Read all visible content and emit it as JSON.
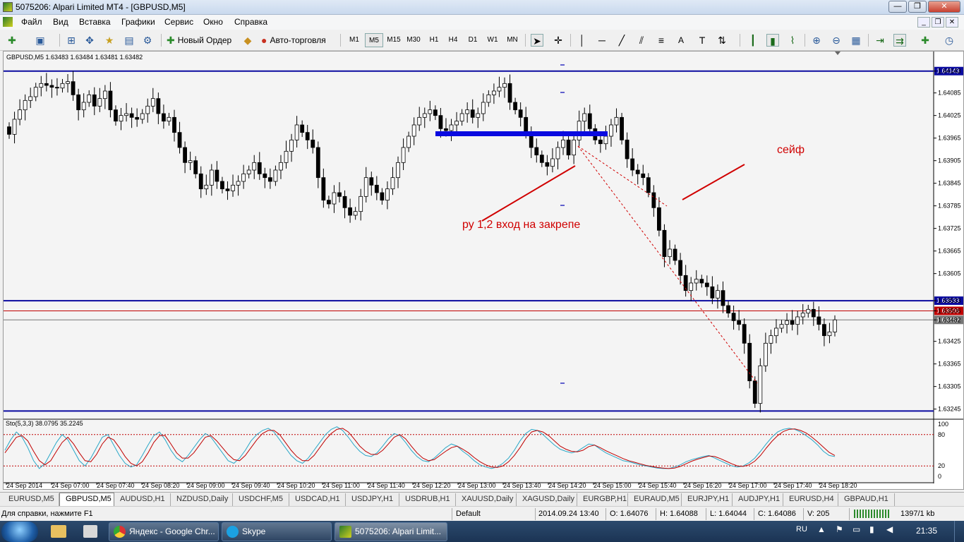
{
  "window": {
    "title": "5075206: Alpari Limited MT4 - [GBPUSD,M5]",
    "controls": [
      "—",
      "❐",
      "✕"
    ]
  },
  "menu": [
    "Файл",
    "Вид",
    "Вставка",
    "Графики",
    "Сервис",
    "Окно",
    "Справка"
  ],
  "toolbar": {
    "new_order": "Новый Ордер",
    "auto_trading": "Авто-торговля",
    "timeframes": [
      "M1",
      "M5",
      "M15",
      "M30",
      "H1",
      "H4",
      "D1",
      "W1",
      "MN"
    ],
    "selected_timeframe": "M5",
    "text_tool": "A"
  },
  "chart": {
    "header": "GBPUSD,M5  1.63483 1.63484 1.63481 1.63482",
    "annotation_entry": "ру 1,2 вход на закрепе",
    "annotation_safe": "сейф",
    "indicator_header": "Sto(5,3,3) 38.0795 35.2245",
    "colors": {
      "up": "#00c000",
      "down": "#000000",
      "hline_blue": "#0a0aa0",
      "hline_red": "#c00000",
      "annotation": "#d00000",
      "stoch_main": "#2aa8c8",
      "stoch_signal": "#c00000"
    }
  },
  "chart_data": {
    "type": "candlestick",
    "symbol": "GBPUSD",
    "timeframe": "M5",
    "price_axis_labels": [
      "1.64143",
      "1.64085",
      "1.64025",
      "1.63965",
      "1.63905",
      "1.63845",
      "1.63785",
      "1.63725",
      "1.63665",
      "1.63605",
      "1.63533",
      "1.63506",
      "1.63482",
      "1.63425",
      "1.63365",
      "1.63305",
      "1.63245"
    ],
    "horizontal_lines": [
      {
        "price": 1.64143,
        "label": "1.64143",
        "color": "#0a0aa0"
      },
      {
        "price": 1.63533,
        "label": "1.63533",
        "color": "#0a0aa0"
      },
      {
        "price": 1.63506,
        "label": "1.63506",
        "color": "#c00000"
      },
      {
        "price": 1.63482,
        "label": "1.63482",
        "color": "#777777"
      },
      {
        "price": 1.6324,
        "label": "",
        "color": "#0a0aa0"
      }
    ],
    "ylim": [
      1.6322,
      1.6418
    ],
    "time_labels": [
      "24 Sep 2014",
      "24 Sep 07:00",
      "24 Sep 07:40",
      "24 Sep 08:20",
      "24 Sep 09:00",
      "24 Sep 09:40",
      "24 Sep 10:20",
      "24 Sep 11:00",
      "24 Sep 11:40",
      "24 Sep 12:20",
      "24 Sep 13:00",
      "24 Sep 13:40",
      "24 Sep 14:20",
      "24 Sep 15:00",
      "24 Sep 15:40",
      "24 Sep 16:20",
      "24 Sep 17:00",
      "24 Sep 17:40",
      "24 Sep 18:20"
    ],
    "closes": [
      1.63975,
      1.64015,
      1.6404,
      1.64065,
      1.64075,
      1.641,
      1.6411,
      1.64105,
      1.641,
      1.64098,
      1.6411,
      1.64115,
      1.6408,
      1.6404,
      1.6406,
      1.6408,
      1.6405,
      1.6407,
      1.6409,
      1.6404,
      1.6401,
      1.64025,
      1.6403,
      1.6402,
      1.64015,
      1.6403,
      1.6405,
      1.6407,
      1.6403,
      1.6401,
      1.6402,
      1.6398,
      1.6394,
      1.639,
      1.63905,
      1.6387,
      1.6383,
      1.6384,
      1.6388,
      1.6385,
      1.6383,
      1.63825,
      1.6384,
      1.6385,
      1.6387,
      1.6388,
      1.639,
      1.6387,
      1.6386,
      1.6385,
      1.6388,
      1.639,
      1.6393,
      1.6396,
      1.64,
      1.6398,
      1.6396,
      1.6394,
      1.6386,
      1.638,
      1.6379,
      1.6382,
      1.6381,
      1.6378,
      1.6376,
      1.6377,
      1.6381,
      1.6386,
      1.6384,
      1.6382,
      1.638,
      1.6383,
      1.6386,
      1.639,
      1.6394,
      1.6397,
      1.64,
      1.6402,
      1.6403,
      1.6404,
      1.64025,
      1.6399,
      1.63985,
      1.64,
      1.6401,
      1.6403,
      1.6404,
      1.6402,
      1.6403,
      1.6406,
      1.6408,
      1.6409,
      1.641,
      1.6411,
      1.6406,
      1.6404,
      1.6402,
      1.6398,
      1.6394,
      1.6392,
      1.639,
      1.6389,
      1.6391,
      1.6394,
      1.6396,
      1.6392,
      1.6396,
      1.6401,
      1.6403,
      1.6399,
      1.6396,
      1.6395,
      1.6397,
      1.64,
      1.6402,
      1.6396,
      1.6391,
      1.6388,
      1.6387,
      1.6386,
      1.6382,
      1.6378,
      1.6372,
      1.6365,
      1.6367,
      1.6364,
      1.636,
      1.6356,
      1.6358,
      1.6359,
      1.6358,
      1.6357,
      1.6354,
      1.6356,
      1.6352,
      1.635,
      1.6348,
      1.6347,
      1.6342,
      1.6332,
      1.6326,
      1.6336,
      1.6342,
      1.6344,
      1.6346,
      1.6347,
      1.6348,
      1.6347,
      1.6349,
      1.635,
      1.6351,
      1.6349,
      1.6347,
      1.6344,
      1.6345,
      1.63482
    ],
    "stochastic": {
      "name": "Sto(5,3,3)",
      "main_last": 38.0795,
      "signal_last": 35.2245,
      "levels": [
        80,
        20
      ],
      "axis_labels": [
        "100",
        "80",
        "20",
        "0"
      ],
      "main": [
        50,
        70,
        85,
        75,
        55,
        30,
        15,
        25,
        45,
        65,
        80,
        70,
        50,
        30,
        20,
        35,
        55,
        75,
        80,
        60,
        40,
        25,
        18,
        22,
        40,
        60,
        78,
        85,
        70,
        50,
        35,
        28,
        40,
        55,
        70,
        82,
        75,
        60,
        45,
        30,
        25,
        35,
        50,
        68,
        80,
        88,
        92,
        85,
        70,
        55,
        40,
        30,
        25,
        35,
        50,
        65,
        80,
        90,
        95,
        88,
        75,
        60,
        48,
        40,
        38,
        45,
        58,
        72,
        82,
        78,
        65,
        50,
        38,
        30,
        28,
        35,
        45,
        55,
        62,
        58,
        48,
        40,
        30,
        22,
        18,
        15,
        18,
        25,
        35,
        50,
        68,
        82,
        90,
        88,
        80,
        70,
        60,
        52,
        48,
        45,
        48,
        55,
        62,
        60,
        52,
        45,
        40,
        35,
        30,
        28,
        25,
        22,
        20,
        18,
        16,
        15,
        15,
        18,
        22,
        28,
        32,
        35,
        38,
        40,
        35,
        30,
        25,
        20,
        18,
        20,
        26,
        35,
        48,
        62,
        75,
        85,
        90,
        92,
        90,
        85,
        78,
        70,
        60,
        48,
        40,
        38
      ],
      "signal": [
        45,
        60,
        75,
        78,
        68,
        48,
        30,
        22,
        30,
        48,
        65,
        75,
        62,
        45,
        30,
        28,
        42,
        62,
        75,
        70,
        55,
        38,
        25,
        20,
        28,
        45,
        65,
        78,
        78,
        62,
        45,
        35,
        35,
        45,
        60,
        75,
        78,
        68,
        55,
        42,
        32,
        30,
        40,
        55,
        70,
        82,
        88,
        88,
        80,
        65,
        50,
        38,
        30,
        30,
        40,
        55,
        70,
        82,
        90,
        92,
        85,
        72,
        58,
        48,
        42,
        42,
        50,
        62,
        75,
        80,
        72,
        58,
        45,
        35,
        30,
        32,
        40,
        48,
        55,
        58,
        52,
        45,
        36,
        28,
        22,
        18,
        17,
        20,
        28,
        40,
        55,
        72,
        85,
        88,
        85,
        78,
        68,
        58,
        52,
        48,
        47,
        50,
        57,
        60,
        55,
        49,
        44,
        39,
        34,
        30,
        27,
        24,
        21,
        19,
        17,
        16,
        15,
        16,
        19,
        24,
        29,
        33,
        36,
        39,
        38,
        34,
        29,
        24,
        20,
        19,
        22,
        29,
        40,
        54,
        67,
        78,
        86,
        90,
        91,
        88,
        83,
        75,
        66,
        56,
        46,
        40
      ]
    }
  },
  "tabs": [
    "EURUSD,M5",
    "GBPUSD,M5",
    "AUDUSD,H1",
    "NZDUSD,Daily",
    "USDCHF,M5",
    "USDCAD,H1",
    "USDJPY,H1",
    "USDRUB,H1",
    "XAUUSD,Daily",
    "XAGUSD,Daily",
    "EURGBP,H1",
    "EURAUD,M5",
    "EURJPY,H1",
    "AUDJPY,H1",
    "EURUSD,H4",
    "GBPAUD,H1"
  ],
  "active_tab": "GBPUSD,M5",
  "status": {
    "help": "Для справки, нажмите F1",
    "profile": "Default",
    "datetime": "2014.09.24 13:40",
    "open": "O: 1.64076",
    "high": "H: 1.64088",
    "low": "L: 1.64044",
    "close": "C: 1.64086",
    "volume": "V: 205",
    "traffic": "1397/1 kb"
  },
  "taskbar": {
    "apps": [
      "Яндекс - Google Chr...",
      "Skype",
      "5075206: Alpari Limit..."
    ],
    "lang": "RU",
    "time": "21:35"
  }
}
